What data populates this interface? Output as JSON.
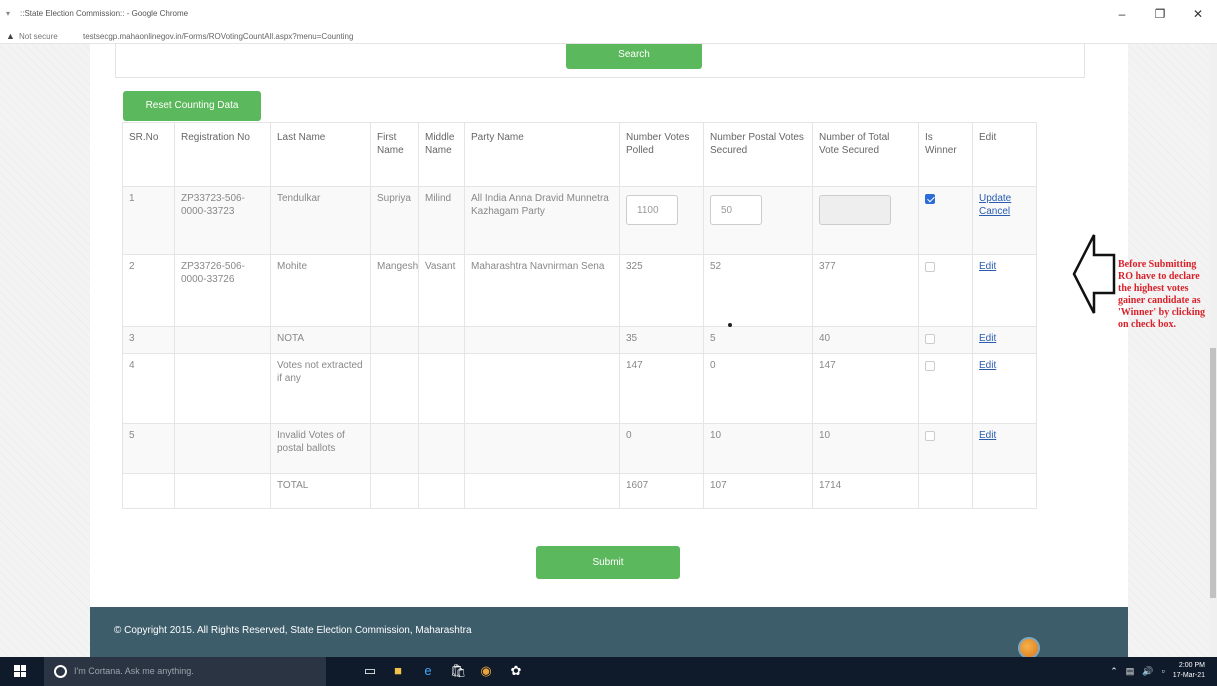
{
  "browser": {
    "window_title": "::State Election Commission:: - Google Chrome",
    "security_label": "Not secure",
    "url": "testsecgp.mahaonlinegov.in/Forms/ROVotingCountAll.aspx?menu=Counting"
  },
  "page": {
    "search_button": "Search",
    "reset_button": "Reset Counting Data",
    "submit_button": "Submit",
    "footer_text": "© Copyright 2015. All Rights Reserved, State Election Commission, Maharashtra"
  },
  "table": {
    "headers": [
      "SR.No",
      "Registration No",
      "Last Name",
      "First Name",
      "Middle Name",
      "Party Name",
      "Number Votes Polled",
      "Number Postal Votes Secured",
      "Number of Total Vote Secured",
      "Is Winner",
      "Edit"
    ],
    "rows": [
      {
        "sr": "1",
        "reg": "ZP33723-506-0000-33723",
        "last": "Tendulkar",
        "first": "Supriya",
        "middle": "Milind",
        "party": "All India Anna Dravid Munnetra Kazhagam Party",
        "votes": "1100",
        "postal": "50",
        "total": "",
        "winner": true,
        "edit1": "Update",
        "edit2": "Cancel"
      },
      {
        "sr": "2",
        "reg": "ZP33726-506-0000-33726",
        "last": "Mohite",
        "first": "Mangesh",
        "middle": "Vasant",
        "party": "Maharashtra Navnirman Sena",
        "votes": "325",
        "postal": "52",
        "total": "377",
        "winner": false,
        "edit1": "Edit"
      },
      {
        "sr": "3",
        "reg": "",
        "last": "NOTA",
        "first": "",
        "middle": "",
        "party": "",
        "votes": "35",
        "postal": "5",
        "total": "40",
        "winner": false,
        "edit1": "Edit"
      },
      {
        "sr": "4",
        "reg": "",
        "last": "Votes not extracted if any",
        "first": "",
        "middle": "",
        "party": "",
        "votes": "147",
        "postal": "0",
        "total": "147",
        "winner": false,
        "edit1": "Edit"
      },
      {
        "sr": "5",
        "reg": "",
        "last": "Invalid Votes of postal ballots",
        "first": "",
        "middle": "",
        "party": "",
        "votes": "0",
        "postal": "10",
        "total": "10",
        "winner": false,
        "edit1": "Edit"
      }
    ],
    "total_row": {
      "label": "TOTAL",
      "votes": "1607",
      "postal": "107",
      "total": "1714"
    }
  },
  "annotation": {
    "text": "Before Submitting RO have to declare the highest votes gainer candidate as 'Winner' by clicking on check box."
  },
  "taskbar": {
    "search_placeholder": "I'm Cortana. Ask me anything.",
    "time": "2:00 PM",
    "date": "17-Mar-21"
  }
}
